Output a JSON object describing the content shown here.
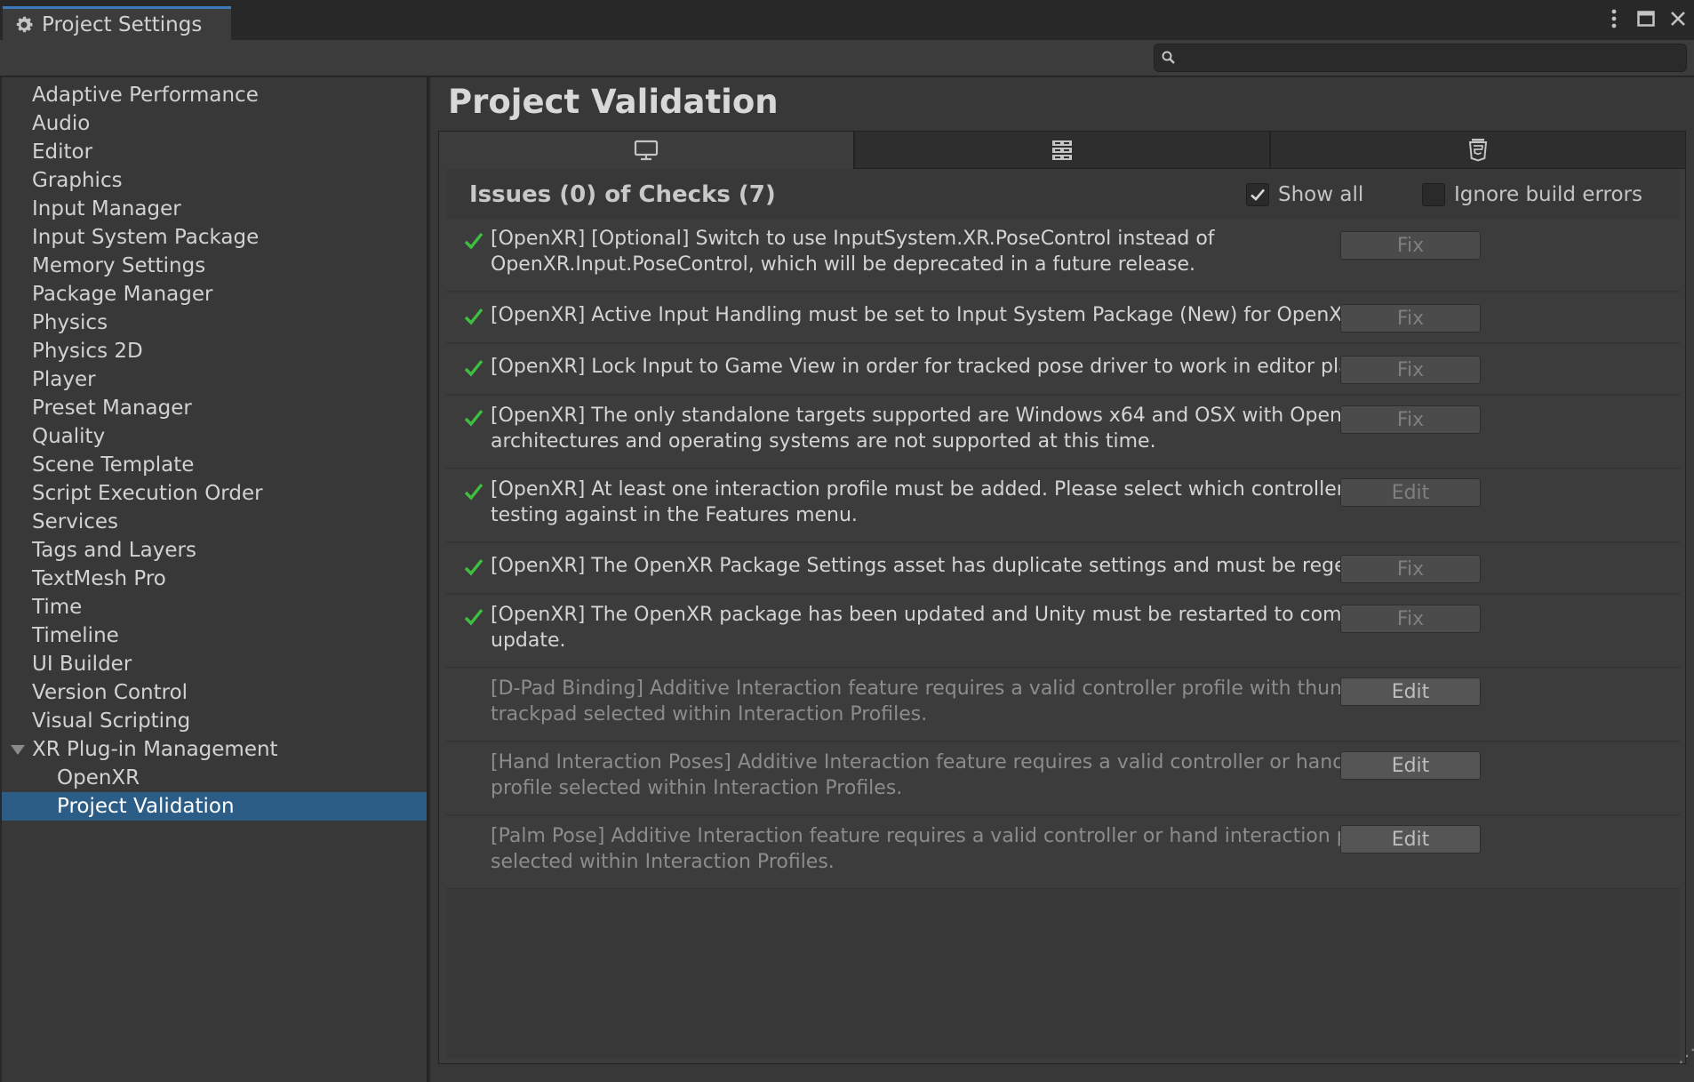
{
  "window": {
    "tab_title": "Project Settings",
    "search": {
      "value": "",
      "placeholder": ""
    }
  },
  "sidebar": {
    "items": [
      {
        "label": "Adaptive Performance"
      },
      {
        "label": "Audio"
      },
      {
        "label": "Editor"
      },
      {
        "label": "Graphics"
      },
      {
        "label": "Input Manager"
      },
      {
        "label": "Input System Package"
      },
      {
        "label": "Memory Settings"
      },
      {
        "label": "Package Manager"
      },
      {
        "label": "Physics"
      },
      {
        "label": "Physics 2D"
      },
      {
        "label": "Player"
      },
      {
        "label": "Preset Manager"
      },
      {
        "label": "Quality"
      },
      {
        "label": "Scene Template"
      },
      {
        "label": "Script Execution Order"
      },
      {
        "label": "Services"
      },
      {
        "label": "Tags and Layers"
      },
      {
        "label": "TextMesh Pro"
      },
      {
        "label": "Time"
      },
      {
        "label": "Timeline"
      },
      {
        "label": "UI Builder"
      },
      {
        "label": "Version Control"
      },
      {
        "label": "Visual Scripting"
      },
      {
        "label": "XR Plug-in Management",
        "expanded": true
      },
      {
        "label": "OpenXR",
        "child": true
      },
      {
        "label": "Project Validation",
        "child": true,
        "selected": true
      }
    ]
  },
  "main": {
    "title": "Project Validation",
    "platform_tabs": [
      {
        "icon": "monitor-icon",
        "active": true
      },
      {
        "icon": "server-icon",
        "active": false
      },
      {
        "icon": "html5-icon",
        "active": false
      }
    ],
    "summary": "Issues (0) of Checks (7)",
    "show_all": {
      "label": "Show all",
      "checked": true
    },
    "ignore_build_errors": {
      "label": "Ignore build errors",
      "checked": false
    },
    "checks": [
      {
        "passed": true,
        "message": "[OpenXR] [Optional] Switch to use InputSystem.XR.PoseControl instead of OpenXR.Input.PoseControl, which will be deprecated in a future release.",
        "button": "Fix"
      },
      {
        "passed": true,
        "message": "[OpenXR] Active Input Handling must be set to Input System Package (New) for OpenXR.",
        "button": "Fix"
      },
      {
        "passed": true,
        "message": "[OpenXR] Lock Input to Game View in order for tracked pose driver to work in editor playmode.",
        "button": "Fix"
      },
      {
        "passed": true,
        "message": "[OpenXR] The only standalone targets supported are Windows x64 and OSX with OpenXR.  Other architectures and operating systems are not supported at this time.",
        "button": "Fix"
      },
      {
        "passed": true,
        "message": "[OpenXR] At least one interaction profile must be added.  Please select which controllers you will be testing against in the Features menu.",
        "button": "Edit"
      },
      {
        "passed": true,
        "message": "[OpenXR] The OpenXR Package Settings asset has duplicate settings and must be regenerated.",
        "button": "Fix"
      },
      {
        "passed": true,
        "message": "[OpenXR] The OpenXR package has been updated and Unity must be restarted to complete the update.",
        "button": "Fix"
      },
      {
        "passed": false,
        "message": "[D-Pad Binding] Additive Interaction feature requires a valid controller profile with thumbstick or trackpad selected within Interaction Profiles.",
        "button": "Edit"
      },
      {
        "passed": false,
        "message": "[Hand Interaction Poses] Additive Interaction feature requires a valid controller or hand interaction profile selected within Interaction Profiles.",
        "button": "Edit"
      },
      {
        "passed": false,
        "message": "[Palm Pose] Additive Interaction feature requires a valid controller or hand interaction profile selected within Interaction Profiles.",
        "button": "Edit"
      }
    ]
  },
  "colors": {
    "accent": "#2c5d87",
    "check": "#3fbf3f"
  }
}
